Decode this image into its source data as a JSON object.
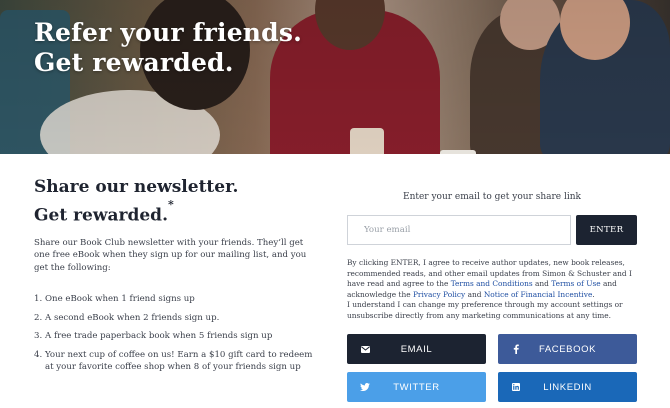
{
  "hero": {
    "title_line1": "Refer your friends.",
    "title_line2": "Get rewarded."
  },
  "newsletter": {
    "heading_line1": "Share our newsletter.",
    "heading_line2": "Get rewarded.",
    "heading_mark": "*",
    "intro": "Share our Book Club newsletter with your friends. They’ll get one free eBook when they sign up for our mailing list, and you get the following:",
    "benefits": [
      {
        "num": "1.",
        "text": "One eBook when 1 friend signs up"
      },
      {
        "num": "2.",
        "text": "A second eBook when 2 friends sign up."
      },
      {
        "num": "3.",
        "text": "A free trade paperback book when 5 friends sign up"
      },
      {
        "num": "4.",
        "text": "Your next cup of coffee on us! Earn a $10 gift card to redeem at your favorite coffee shop when 8 of your friends sign up"
      }
    ]
  },
  "signup": {
    "prompt": "Enter your email to get your share link",
    "email_placeholder": "Your email",
    "email_value": "",
    "enter_label": "ENTER",
    "legal": {
      "part1": "By clicking ENTER, I agree to receive author updates, new book releases, recommended reads, and other email updates from Simon & Schuster and I have read and agree to the ",
      "terms_conditions": "Terms and Conditions",
      "and1": " and ",
      "terms_use": "Terms of Use",
      "part2": " and acknowledge the ",
      "privacy_policy": "Privacy Policy",
      "and2": " and ",
      "financial_incentive": "Notice of Financial Incentive",
      "part3": ".",
      "part4": "I understand I can change my preference through my account settings or unsubscribe directly from any marketing communications at any time."
    }
  },
  "share": {
    "email_label": "EMAIL",
    "facebook_label": "FACEBOOK",
    "twitter_label": "TWITTER",
    "linkedin_label": "LINKEDIN",
    "colors": {
      "email": "#1c2331",
      "facebook": "#3d5a99",
      "twitter": "#4b9fe8",
      "linkedin": "#1a68b8"
    }
  }
}
